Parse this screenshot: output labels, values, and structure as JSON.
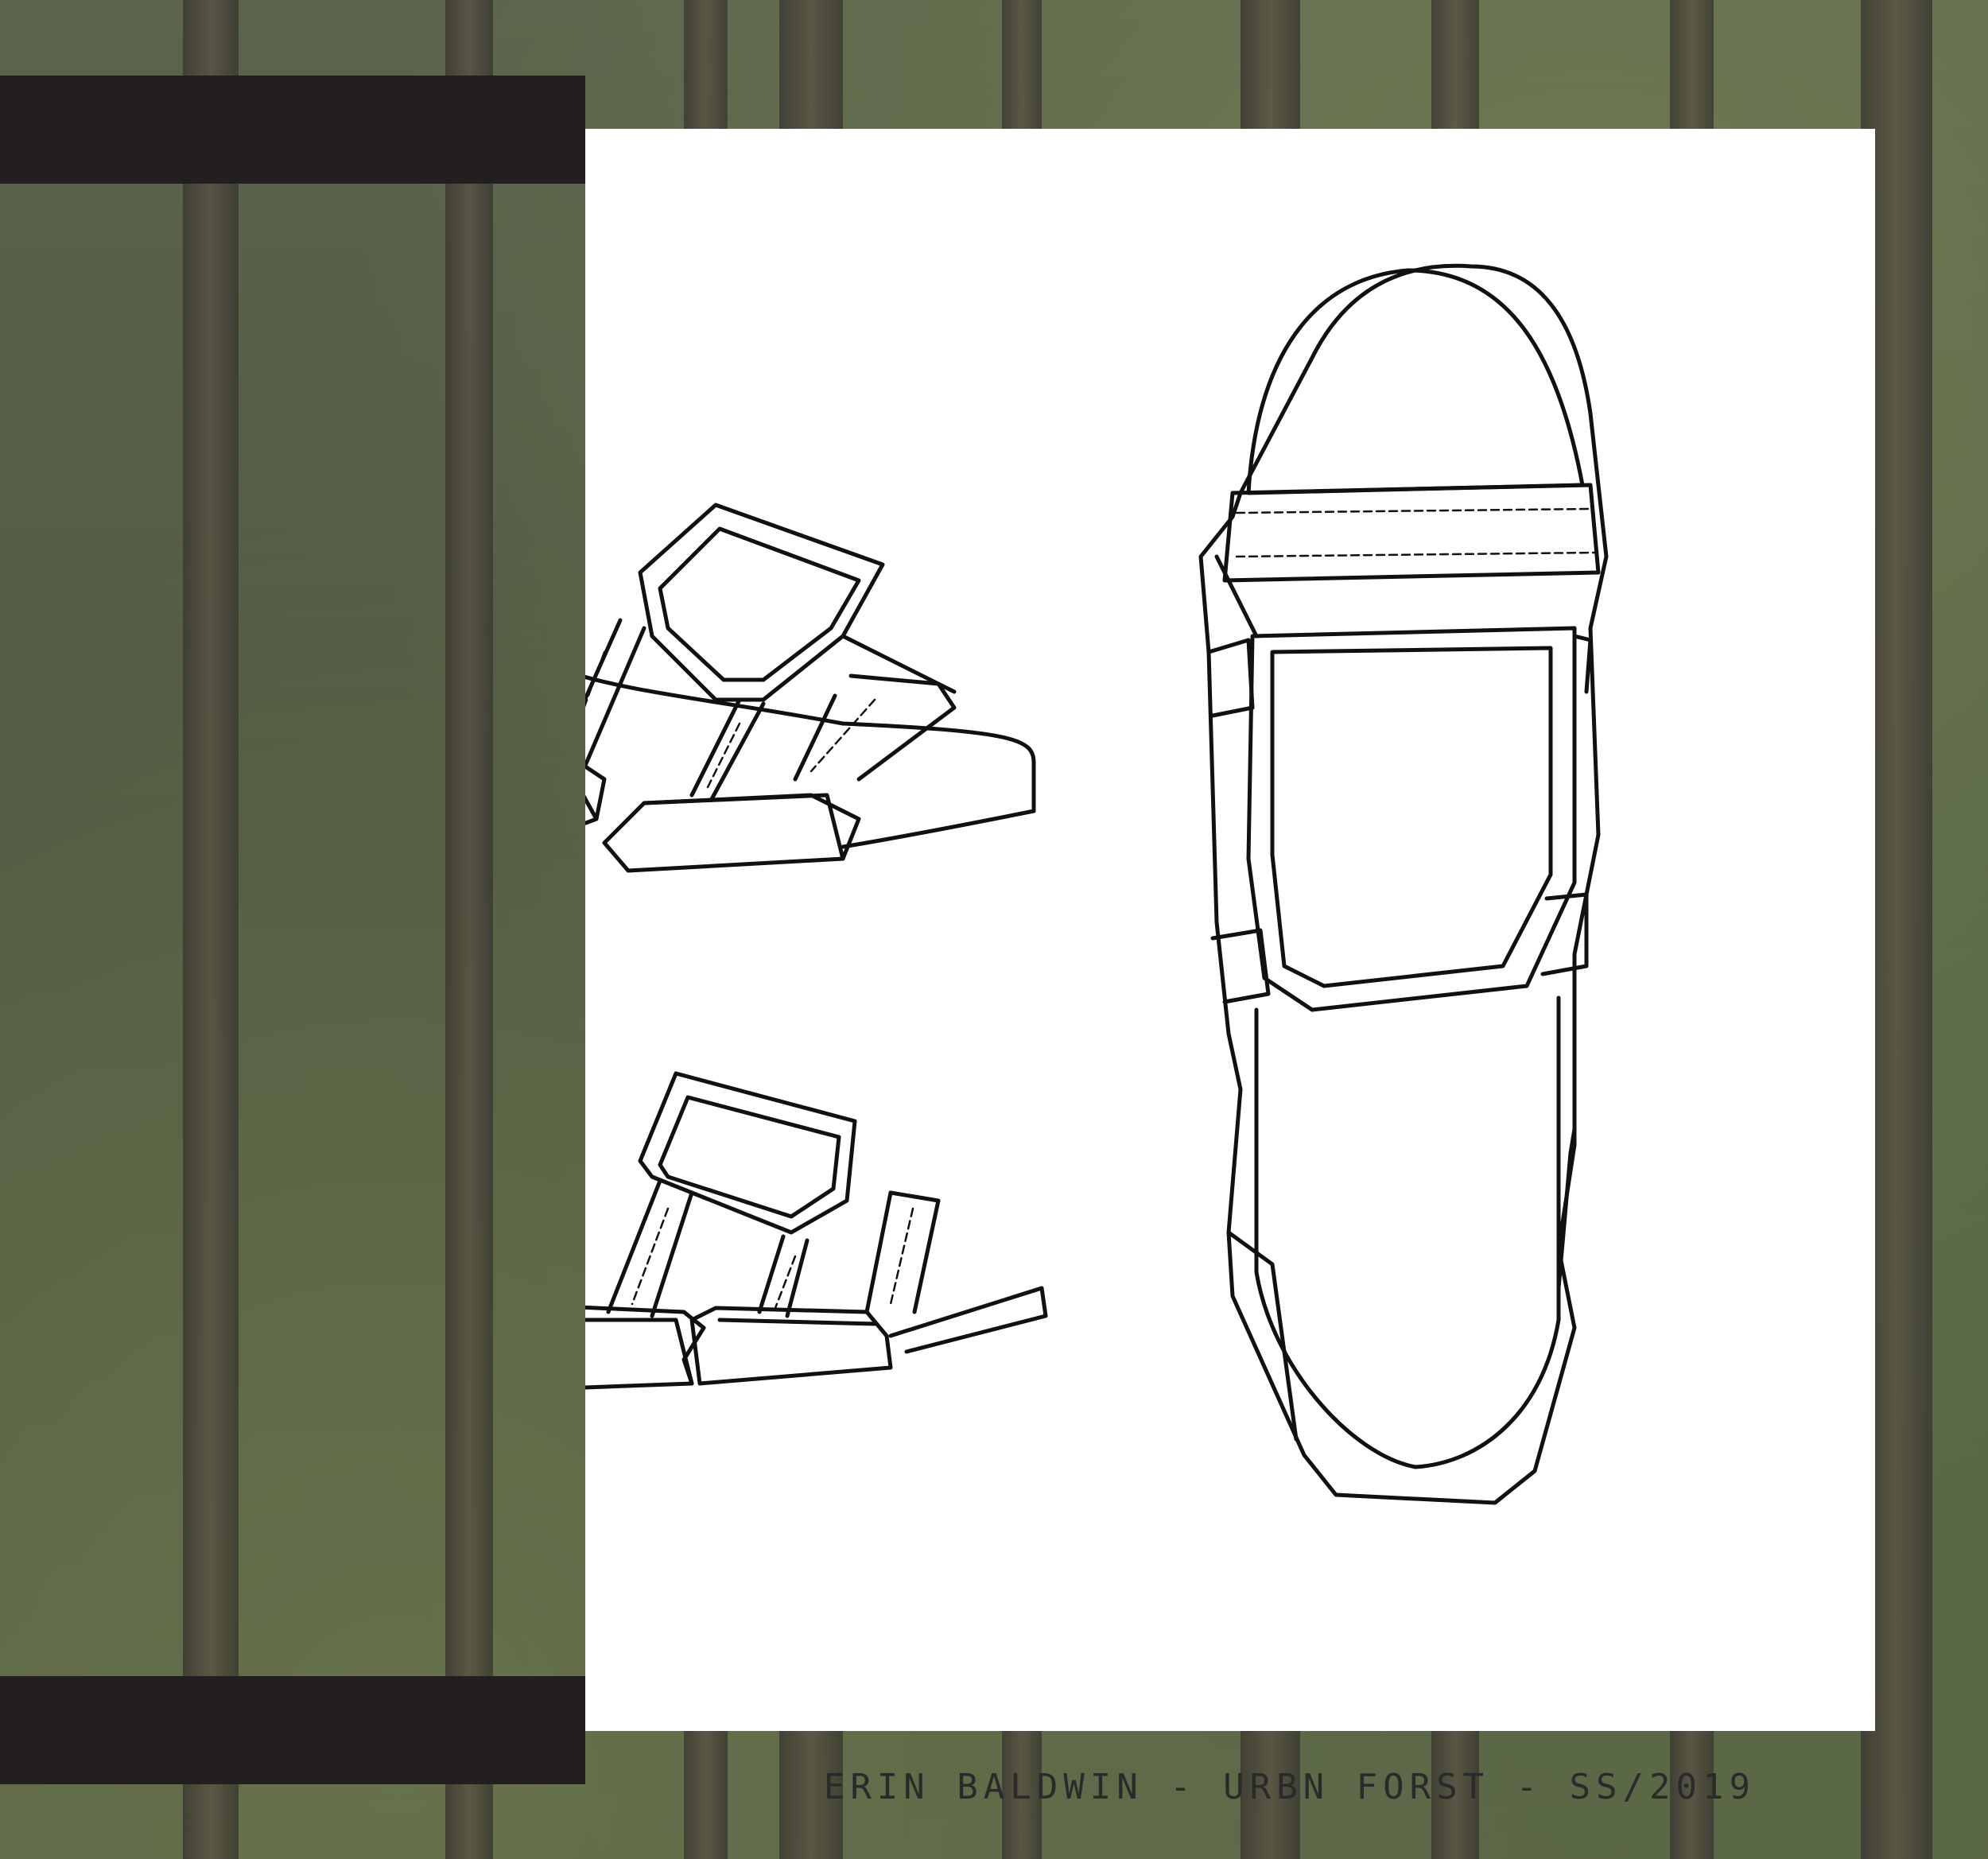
{
  "caption": "ERIN BALDWIN - URBN FORST - SS/2019",
  "background": {
    "subject": "forest",
    "colors": {
      "foliage": "#5b6446",
      "trunk": "#4a3c2e",
      "bar": "#231f20",
      "card": "#ffffff"
    }
  },
  "sketches": [
    {
      "name": "sandal-three-quarter-view"
    },
    {
      "name": "sandal-side-view"
    },
    {
      "name": "sandal-top-view"
    }
  ]
}
